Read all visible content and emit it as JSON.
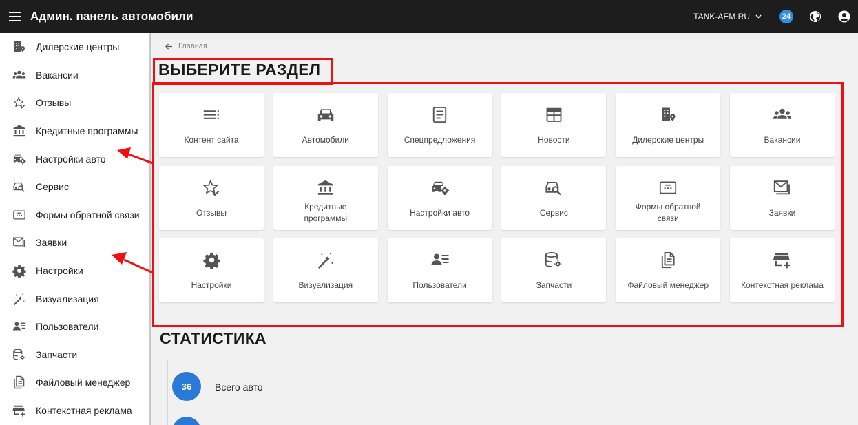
{
  "header": {
    "title": "Админ. панель автомобили",
    "site": "TANK-AEM.RU",
    "notifications_count": "24"
  },
  "sidebar": {
    "items": [
      {
        "label": "Дилерские центры",
        "icon": "dealer-building-icon"
      },
      {
        "label": "Вакансии",
        "icon": "people-group-icon"
      },
      {
        "label": "Отзывы",
        "icon": "star-check-icon"
      },
      {
        "label": "Кредитные программы",
        "icon": "bank-icon"
      },
      {
        "label": "Настройки авто",
        "icon": "car-settings-icon"
      },
      {
        "label": "Сервис",
        "icon": "car-search-icon"
      },
      {
        "label": "Формы обратной связи",
        "icon": "feedback-form-icon"
      },
      {
        "label": "Заявки",
        "icon": "inbox-mail-icon"
      },
      {
        "label": "Настройки",
        "icon": "gear-icon"
      },
      {
        "label": "Визуализация",
        "icon": "magic-wand-icon"
      },
      {
        "label": "Пользователи",
        "icon": "user-list-icon"
      },
      {
        "label": "Запчасти",
        "icon": "database-gear-icon"
      },
      {
        "label": "Файловый менеджер",
        "icon": "file-copy-icon"
      },
      {
        "label": "Контекстная реклама",
        "icon": "store-add-icon"
      }
    ]
  },
  "breadcrumb": {
    "label": "Главная"
  },
  "sections_title": "ВЫБЕРИТЕ РАЗДЕЛ",
  "cards": [
    {
      "label": "Контент сайта",
      "icon": "content-list-icon"
    },
    {
      "label": "Автомобили",
      "icon": "car-icon"
    },
    {
      "label": "Спецпредложения",
      "icon": "document-icon"
    },
    {
      "label": "Новости",
      "icon": "calendar-news-icon"
    },
    {
      "label": "Дилерские центры",
      "icon": "dealer-building-icon"
    },
    {
      "label": "Вакансии",
      "icon": "people-group-icon"
    },
    {
      "label": "Отзывы",
      "icon": "star-check-icon"
    },
    {
      "label": "Кредитные программы",
      "icon": "bank-icon"
    },
    {
      "label": "Настройки авто",
      "icon": "car-settings-icon"
    },
    {
      "label": "Сервис",
      "icon": "car-search-icon"
    },
    {
      "label": "Формы обратной связи",
      "icon": "feedback-form-icon"
    },
    {
      "label": "Заявки",
      "icon": "inbox-mail-icon"
    },
    {
      "label": "Настройки",
      "icon": "gear-icon"
    },
    {
      "label": "Визуализация",
      "icon": "magic-wand-icon"
    },
    {
      "label": "Пользователи",
      "icon": "user-list-icon"
    },
    {
      "label": "Запчасти",
      "icon": "database-gear-icon"
    },
    {
      "label": "Файловый менеджер",
      "icon": "file-copy-icon"
    },
    {
      "label": "Контекстная реклама",
      "icon": "store-add-icon"
    }
  ],
  "stats_title": "СТАТИСТИКА",
  "stats": [
    {
      "value": "36",
      "label": "Всего авто"
    }
  ],
  "colors": {
    "topbar": "#1d1d1d",
    "badge": "#2f8fe0",
    "stat_circle": "#2979d6",
    "annotation": "#e11111"
  }
}
